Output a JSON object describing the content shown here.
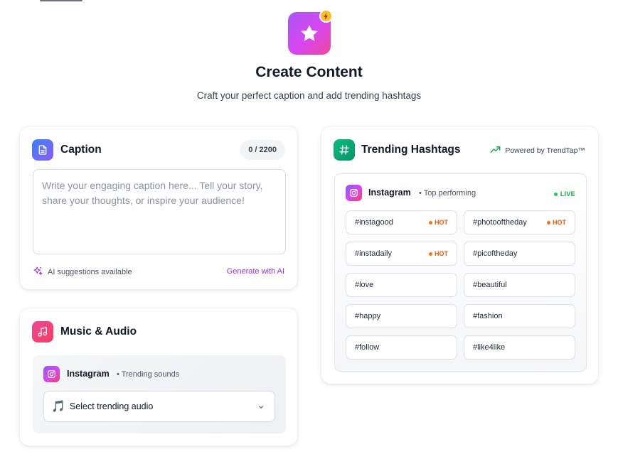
{
  "header": {
    "title": "Create Content",
    "subtitle": "Craft your perfect caption and add trending hashtags",
    "icon": "star-icon",
    "badge_icon": "lightning-icon"
  },
  "caption": {
    "title": "Caption",
    "counter": "0 / 2200",
    "value": "",
    "placeholder": "Write your engaging caption here... Tell your story, share your thoughts, or inspire your audience!",
    "ai_text": "AI suggestions available",
    "generate_label": "Generate with AI",
    "icon": "document-icon"
  },
  "music": {
    "title": "Music & Audio",
    "platform": "Instagram",
    "platform_sub": "• Trending sounds",
    "select_emoji": "🎵",
    "select_label": "Select trending audio",
    "icon": "music-note-icon"
  },
  "hashtags": {
    "title": "Trending Hashtags",
    "powered_by": "Powered by TrendTap™",
    "platform": "Instagram",
    "platform_sub": "• Top performing",
    "live_label": "LIVE",
    "hot_label": "HOT",
    "icon": "hash-icon",
    "tags": [
      {
        "label": "#instagood",
        "hot": true
      },
      {
        "label": "#photooftheday",
        "hot": true
      },
      {
        "label": "#instadaily",
        "hot": true
      },
      {
        "label": "#picoftheday",
        "hot": false
      },
      {
        "label": "#love",
        "hot": false
      },
      {
        "label": "#beautiful",
        "hot": false
      },
      {
        "label": "#happy",
        "hot": false
      },
      {
        "label": "#fashion",
        "hot": false
      },
      {
        "label": "#follow",
        "hot": false
      },
      {
        "label": "#like4like",
        "hot": false
      }
    ]
  },
  "colors": {
    "accent_purple": "#9333ea",
    "hot_orange": "#ea580c",
    "live_green": "#16a34a",
    "hashtag_icon_green": "#10b981"
  }
}
